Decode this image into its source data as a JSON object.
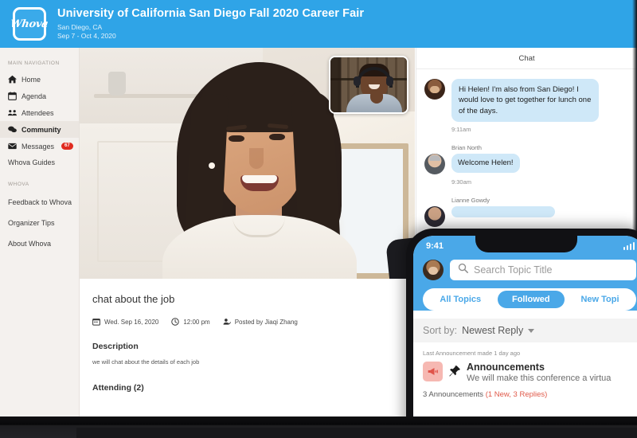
{
  "header": {
    "logo_text": "Whova",
    "title": "University of California San Diego Fall 2020 Career Fair",
    "location": "San Diego, CA",
    "dates": "Sep 7 - Oct 4, 2020",
    "brand_color": "#2fa4e7"
  },
  "sidebar": {
    "section_main_label": "MAIN NAVIGATION",
    "items": [
      {
        "label": "Home",
        "icon": "home-icon"
      },
      {
        "label": "Agenda",
        "icon": "calendar-icon"
      },
      {
        "label": "Attendees",
        "icon": "people-icon"
      },
      {
        "label": "Community",
        "icon": "chat-bubbles-icon"
      },
      {
        "label": "Messages",
        "icon": "envelope-icon",
        "badge": "67"
      },
      {
        "label": "Whova Guides",
        "icon": "none"
      }
    ],
    "section_whova_label": "WHOVA",
    "whova_items": [
      {
        "label": "Feedback to Whova"
      },
      {
        "label": "Organizer Tips"
      },
      {
        "label": "About Whova"
      }
    ],
    "badge_color": "#e02b20"
  },
  "session": {
    "title": "chat about the job",
    "date": "Wed. Sep 16, 2020",
    "time": "12:00 pm",
    "posted_by": "Posted by Jiaqi Zhang",
    "description_heading": "Description",
    "description_body": "we will chat about the details of each job",
    "attending": "Attending (2)"
  },
  "chat": {
    "title": "Chat",
    "messages": [
      {
        "sender": "",
        "text": "Hi Helen! I'm also from San Diego! I would love to get together for lunch one of the days.",
        "time": "9:11am"
      },
      {
        "sender": "Brian North",
        "text": "Welcome Helen!",
        "time": "9:30am"
      },
      {
        "sender": "Lianne Gowdy",
        "text": "",
        "time": ""
      }
    ],
    "bubble_color": "#cfe8f8"
  },
  "phone": {
    "status_time": "9:41",
    "search_placeholder": "Search Topic Title",
    "tabs": [
      {
        "label": "All Topics",
        "active": false
      },
      {
        "label": "Followed",
        "active": true
      },
      {
        "label": "New Topi",
        "active": false
      }
    ],
    "sort_label": "Sort by:",
    "sort_value": "Newest Reply",
    "last_announcement": "Last Announcement made 1 day ago",
    "announcement_title": "Announcements",
    "announcement_preview": "We will make this conference a virtua",
    "announcement_count": "3 Announcements ",
    "announcement_meta": "(1 New, 3 Replies)",
    "accent_color": "#4aa8e8"
  }
}
